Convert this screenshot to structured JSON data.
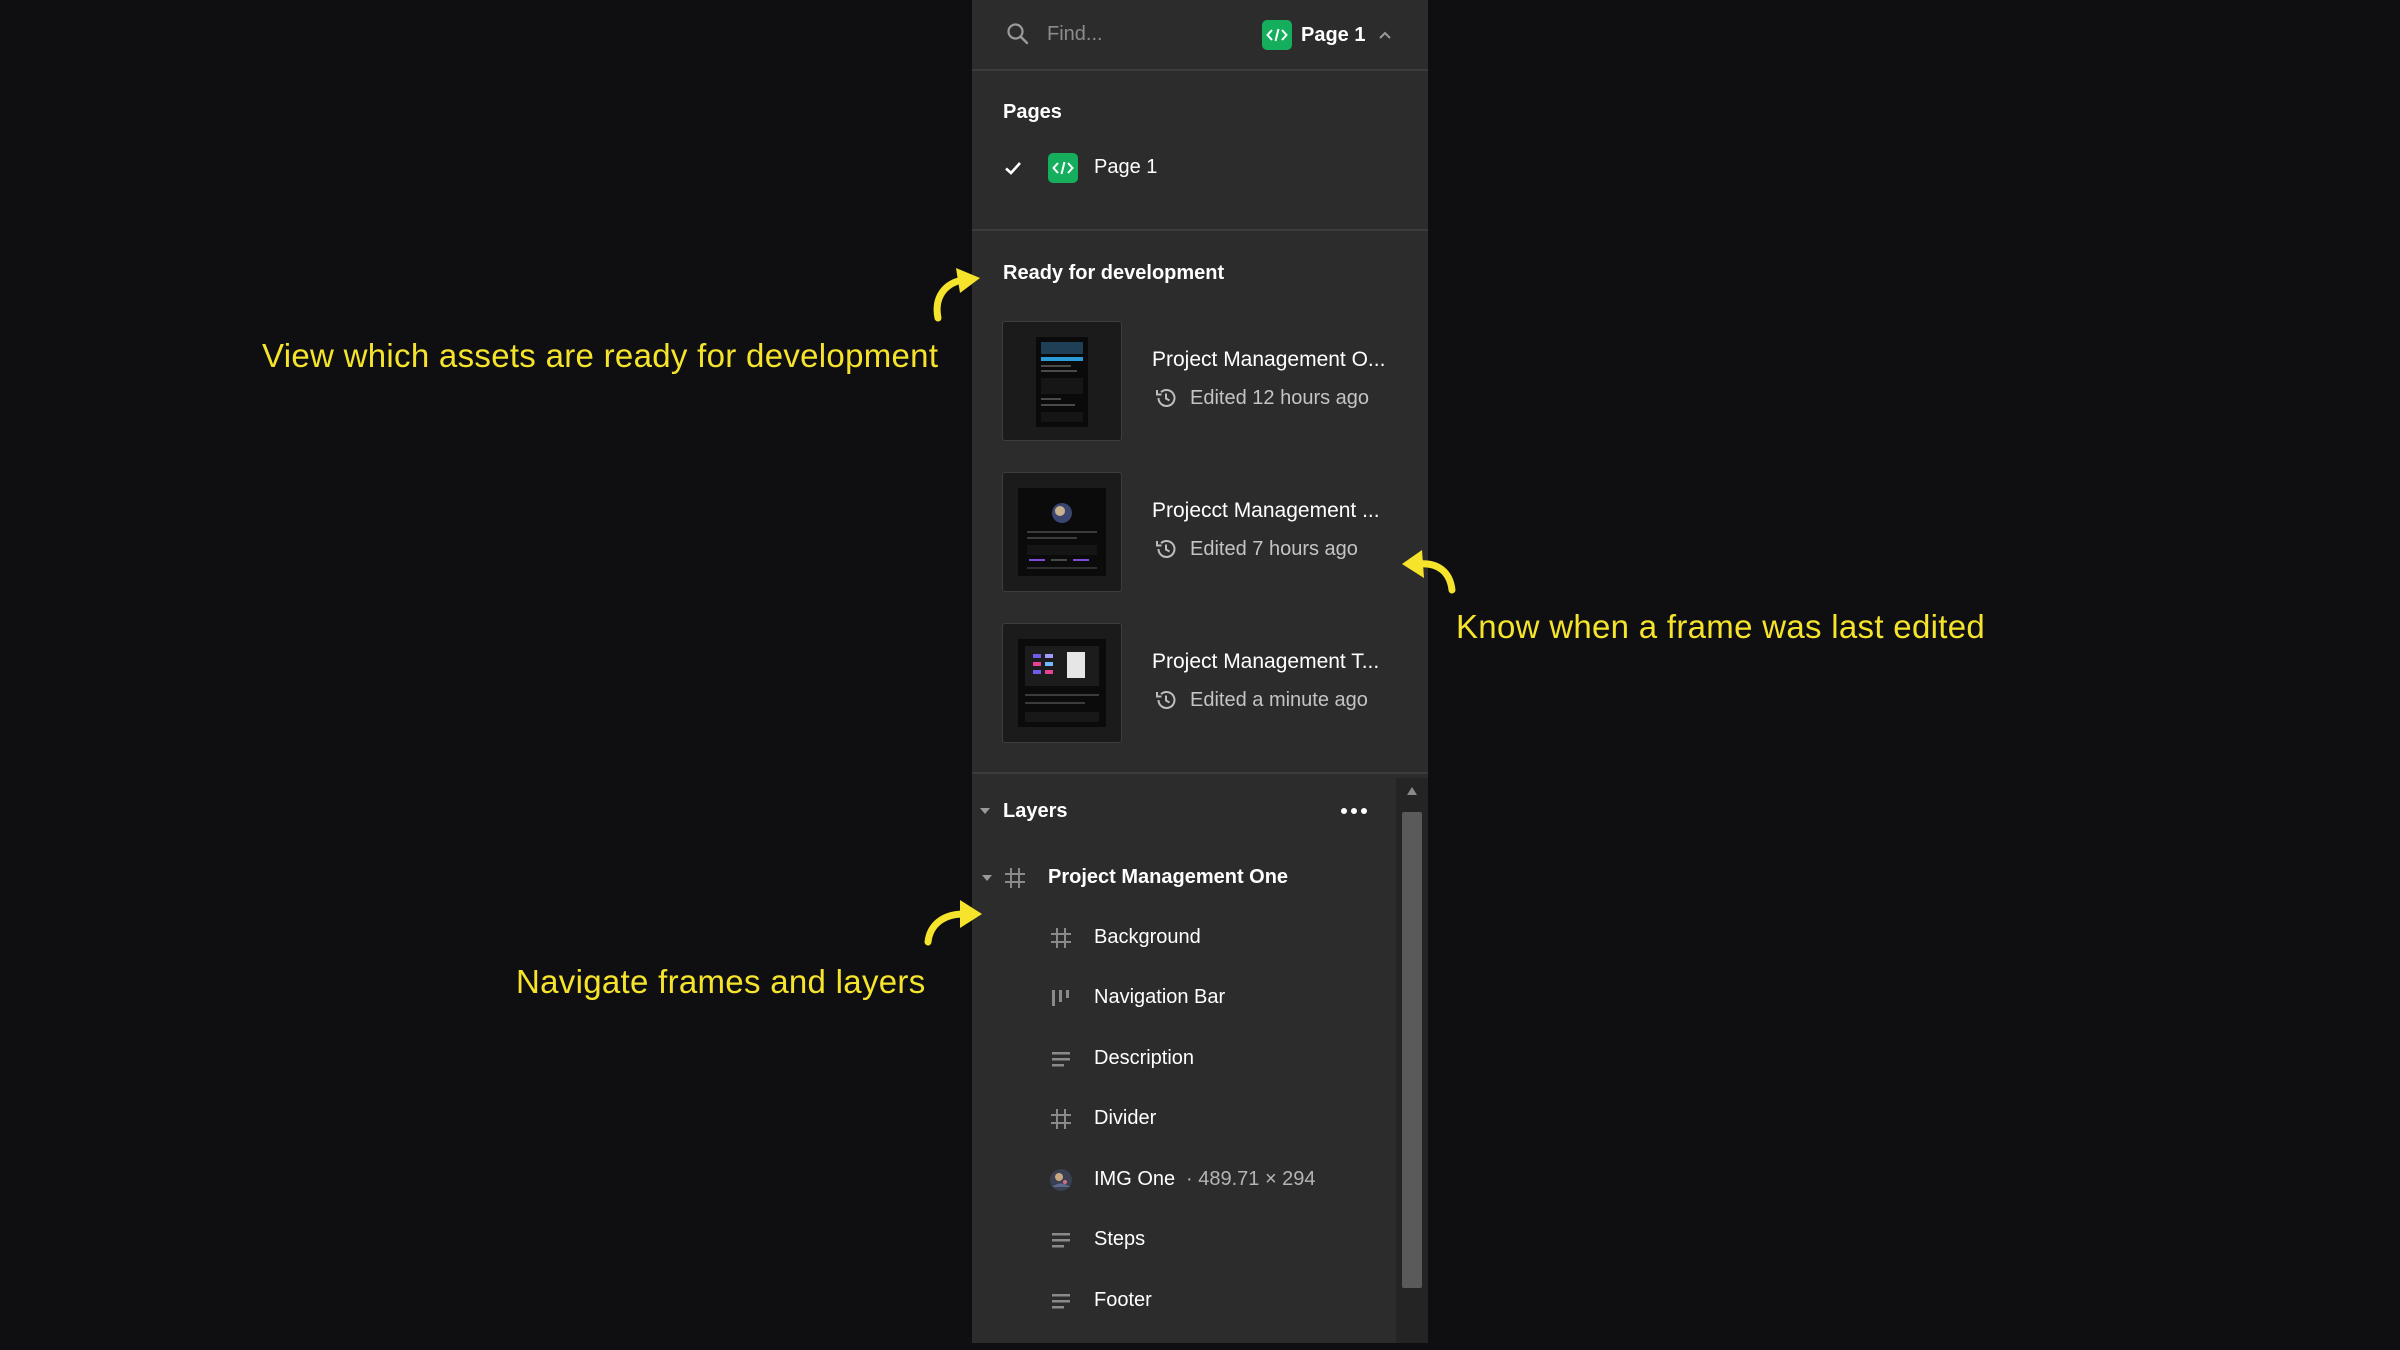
{
  "search": {
    "placeholder": "Find..."
  },
  "page_switcher": {
    "current_page": "Page 1"
  },
  "pages": {
    "title": "Pages",
    "items": [
      {
        "label": "Page 1",
        "selected": true
      }
    ]
  },
  "ready_for_development": {
    "title": "Ready for development",
    "assets": [
      {
        "name": "Project Management O...",
        "edited": "Edited 12 hours ago"
      },
      {
        "name": "Projecct Management ...",
        "edited": "Edited 7 hours ago"
      },
      {
        "name": "Project Management T...",
        "edited": "Edited a minute ago"
      }
    ]
  },
  "layers": {
    "title": "Layers",
    "frame": {
      "label": "Project Management One",
      "icon": "frame-icon"
    },
    "items": [
      {
        "label": "Background",
        "icon": "frame-icon"
      },
      {
        "label": "Navigation Bar",
        "icon": "auto-layout-horizontal-icon"
      },
      {
        "label": "Description",
        "icon": "text-lines-icon"
      },
      {
        "label": "Divider",
        "icon": "frame-icon"
      },
      {
        "label": "IMG One",
        "detail": "· 489.71 × 294",
        "icon": "image-icon"
      },
      {
        "label": "Steps",
        "icon": "text-lines-icon"
      },
      {
        "label": "Footer",
        "icon": "text-lines-icon"
      }
    ]
  },
  "annotations": {
    "ready": "View which assets are ready for development",
    "edited": "Know when a frame was last edited",
    "navigate": "Navigate frames and layers"
  },
  "colors": {
    "background": "#0f0f11",
    "panel": "#2c2c2c",
    "dev_mode_green": "#14ae5c",
    "annotation_yellow": "#f5e42b"
  }
}
